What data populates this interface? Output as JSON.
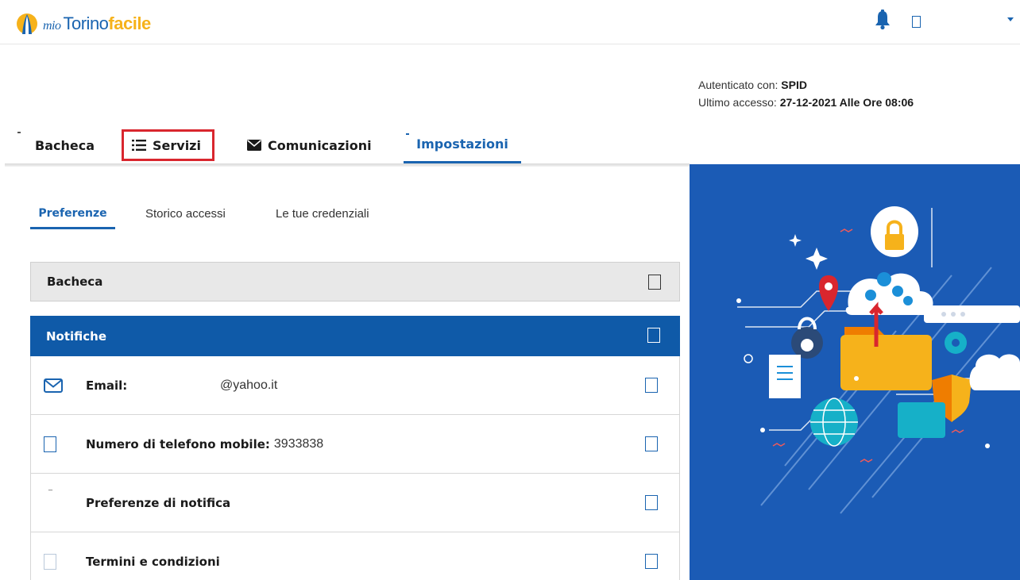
{
  "header": {
    "logo": {
      "mio": "mio",
      "torino": "Torino",
      "facile": "facile"
    },
    "icons": [
      "bell-icon",
      "user-square-icon",
      "caret-down-icon"
    ]
  },
  "auth": {
    "authenticated_label": "Autenticato con:",
    "authenticated_value": "SPID",
    "last_access_label": "Ultimo accesso:",
    "last_access_value": "27-12-2021 Alle Ore 08:06"
  },
  "main_tabs": {
    "bacheca": "Bacheca",
    "servizi": "Servizi",
    "comunicazioni": "Comunicazioni",
    "impostazioni": "Impostazioni",
    "active": "Impostazioni"
  },
  "sub_tabs": {
    "preferenze": "Preferenze",
    "storico": "Storico accessi",
    "credenziali": "Le tue credenziali",
    "active": "Preferenze"
  },
  "accordion": {
    "bacheca": "Bacheca",
    "notifiche": "Notifiche"
  },
  "rows": {
    "email_label": "Email:",
    "email_value": "@yahoo.it",
    "tel_label": "Numero di telefono mobile:",
    "tel_value": "3933838",
    "pref_label": "Preferenze di notifica",
    "term_label": "Termini e condizioni"
  },
  "colors": {
    "brand_blue": "#1a64b0",
    "accordion_active": "#0f5aa8",
    "highlight_red": "#d9262e",
    "logo_yellow": "#f6b21b",
    "panel_blue": "#1b5bb5"
  }
}
